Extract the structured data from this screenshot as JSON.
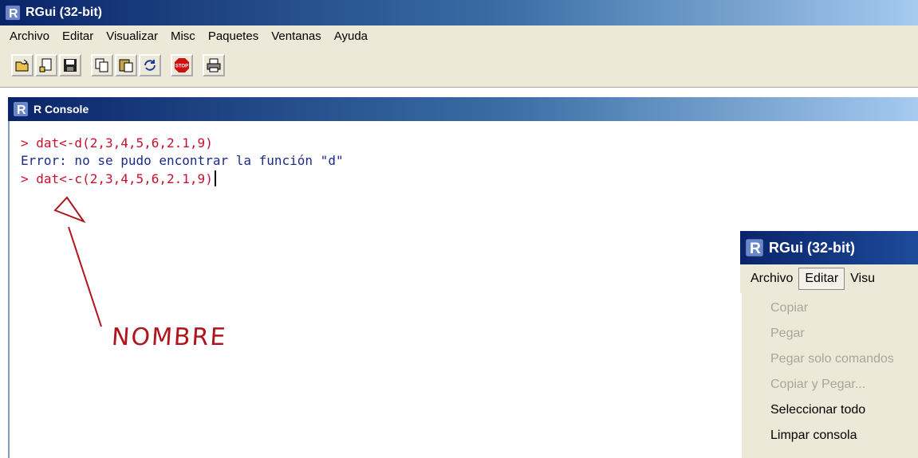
{
  "window": {
    "title": "RGui (32-bit)"
  },
  "menu": [
    "Archivo",
    "Editar",
    "Visualizar",
    "Misc",
    "Paquetes",
    "Ventanas",
    "Ayuda"
  ],
  "toolbar": {
    "buttons": [
      {
        "icon": "open-script-icon"
      },
      {
        "icon": "load-workspace-icon"
      },
      {
        "icon": "save-icon"
      },
      {
        "icon": "copy-icon"
      },
      {
        "icon": "paste-icon"
      },
      {
        "icon": "refresh-icon"
      },
      {
        "icon": "stop-icon",
        "label": "STOP"
      },
      {
        "icon": "print-icon"
      }
    ]
  },
  "console": {
    "title": "R Console",
    "lines": [
      {
        "prompt": "> ",
        "text": "dat<-d(2,3,4,5,6,2.1,9)",
        "kind": "command"
      },
      {
        "prompt": "",
        "text": "Error: no se pudo encontrar la función \"d\"",
        "kind": "error"
      },
      {
        "prompt": "> ",
        "text": "dat<-c(2,3,4,5,6,2.1,9)",
        "kind": "command"
      }
    ]
  },
  "annotation": {
    "label": "NOMBRE",
    "color": "#b0141c"
  },
  "inset": {
    "title": "RGui (32-bit)",
    "menu": [
      "Archivo",
      "Editar",
      "Visu"
    ],
    "active_menu": "Editar",
    "dropdown": [
      {
        "label": "Copiar",
        "enabled": false
      },
      {
        "label": "Pegar",
        "enabled": false
      },
      {
        "label": "Pegar solo comandos",
        "enabled": false
      },
      {
        "label": "Copiar y Pegar...",
        "enabled": false
      },
      {
        "label": "Seleccionar todo",
        "enabled": true
      },
      {
        "label": "Limpar consola",
        "enabled": true
      }
    ]
  },
  "colors": {
    "command": "#c8102e",
    "output": "#1c2a8c",
    "titlebar": "#0a246a"
  }
}
